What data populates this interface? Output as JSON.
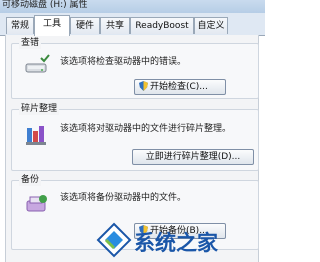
{
  "window": {
    "title": "可移动磁盘 (H:) 属性"
  },
  "tabs": [
    {
      "label": "常规"
    },
    {
      "label": "工具",
      "active": true
    },
    {
      "label": "硬件"
    },
    {
      "label": "共享"
    },
    {
      "label": "ReadyBoost"
    },
    {
      "label": "自定义"
    }
  ],
  "error_check": {
    "title": "查错",
    "description": "该选项将检查驱动器中的错误。",
    "button_label": "开始检查(C)...",
    "icon": "drive-check-icon"
  },
  "defrag": {
    "title": "碎片整理",
    "description": "该选项将对驱动器中的文件进行碎片整理。",
    "button_label": "立即进行碎片整理(D)...",
    "icon": "defrag-icon"
  },
  "backup": {
    "title": "备份",
    "description": "该选项将备份驱动器中的文件。",
    "button_label": "开始备份(B)...",
    "icon": "backup-icon"
  },
  "watermark": {
    "text": "系统之家"
  },
  "colors": {
    "accent": "#1a56a8",
    "tab_bg": "#dfe8f3",
    "panel_bg": "#f3f4f6"
  }
}
